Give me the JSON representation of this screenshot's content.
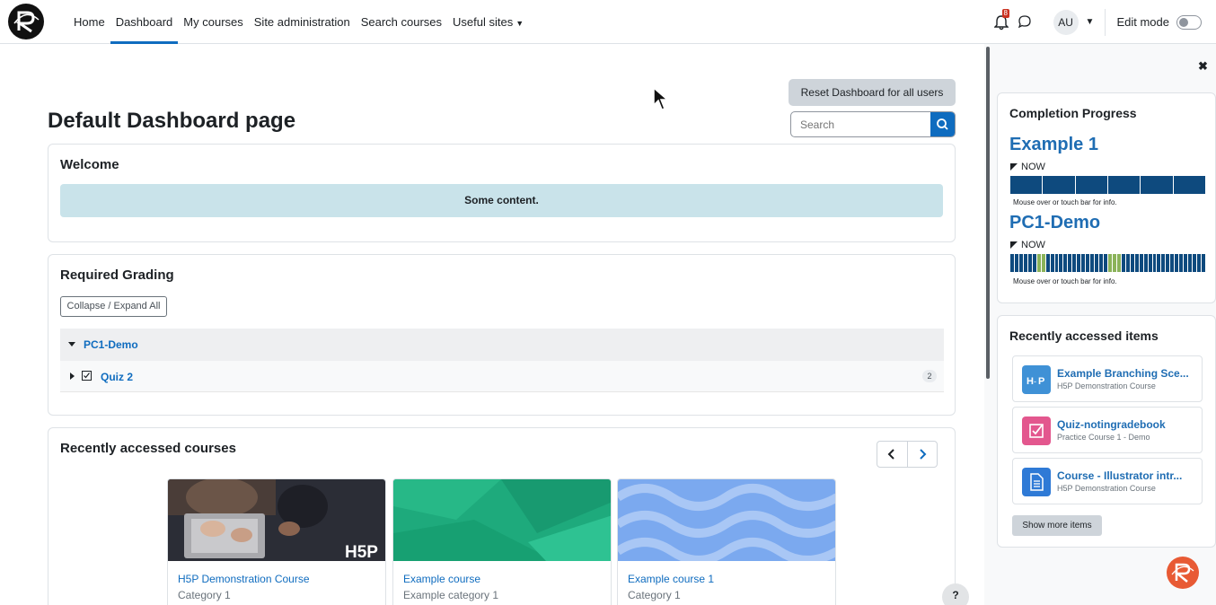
{
  "nav": {
    "items": [
      "Home",
      "Dashboard",
      "My courses",
      "Site administration",
      "Search courses",
      "Useful sites"
    ],
    "active": "Dashboard",
    "notification_count": "8",
    "avatar_initials": "AU",
    "edit_mode_label": "Edit mode",
    "edit_mode_on": false
  },
  "main": {
    "reset_label": "Reset Dashboard for all users",
    "title": "Default Dashboard page",
    "search_placeholder": "Search",
    "welcome": {
      "title": "Welcome",
      "content": "Some content."
    },
    "grading": {
      "title": "Required Grading",
      "collapse_label": "Collapse / Expand All",
      "course": "PC1-Demo",
      "activity": "Quiz 2",
      "count": "2"
    },
    "recent_courses": {
      "title": "Recently accessed courses",
      "courses": [
        {
          "name": "H5P Demonstration Course",
          "category": "Category 1",
          "image_text": "H5P"
        },
        {
          "name": "Example course",
          "category": "Example category 1"
        },
        {
          "name": "Example course 1",
          "category": "Category 1"
        }
      ]
    },
    "help_label": "?"
  },
  "drawer": {
    "progress": {
      "title": "Completion Progress",
      "courses": [
        {
          "name": "Example 1",
          "now": "NOW",
          "note": "Mouse over or touch bar for info."
        },
        {
          "name": "PC1-Demo",
          "now": "NOW",
          "note": "Mouse over or touch bar for info."
        }
      ]
    },
    "recent_items": {
      "title": "Recently accessed items",
      "items": [
        {
          "name": "Example Branching Sce...",
          "course": "H5P Demonstration Course",
          "icon": "h5p-icon"
        },
        {
          "name": "Quiz-notingradebook",
          "course": "Practice Course 1 - Demo",
          "icon": "quiz-icon"
        },
        {
          "name": "Course - Illustrator intr...",
          "course": "H5P Demonstration Course",
          "icon": "file-icon"
        }
      ],
      "show_more_label": "Show more items"
    }
  },
  "colors": {
    "brand": "#0f6cbf",
    "progress_bar": "#0e4a7e",
    "progress_completed": "#8bb35a"
  }
}
